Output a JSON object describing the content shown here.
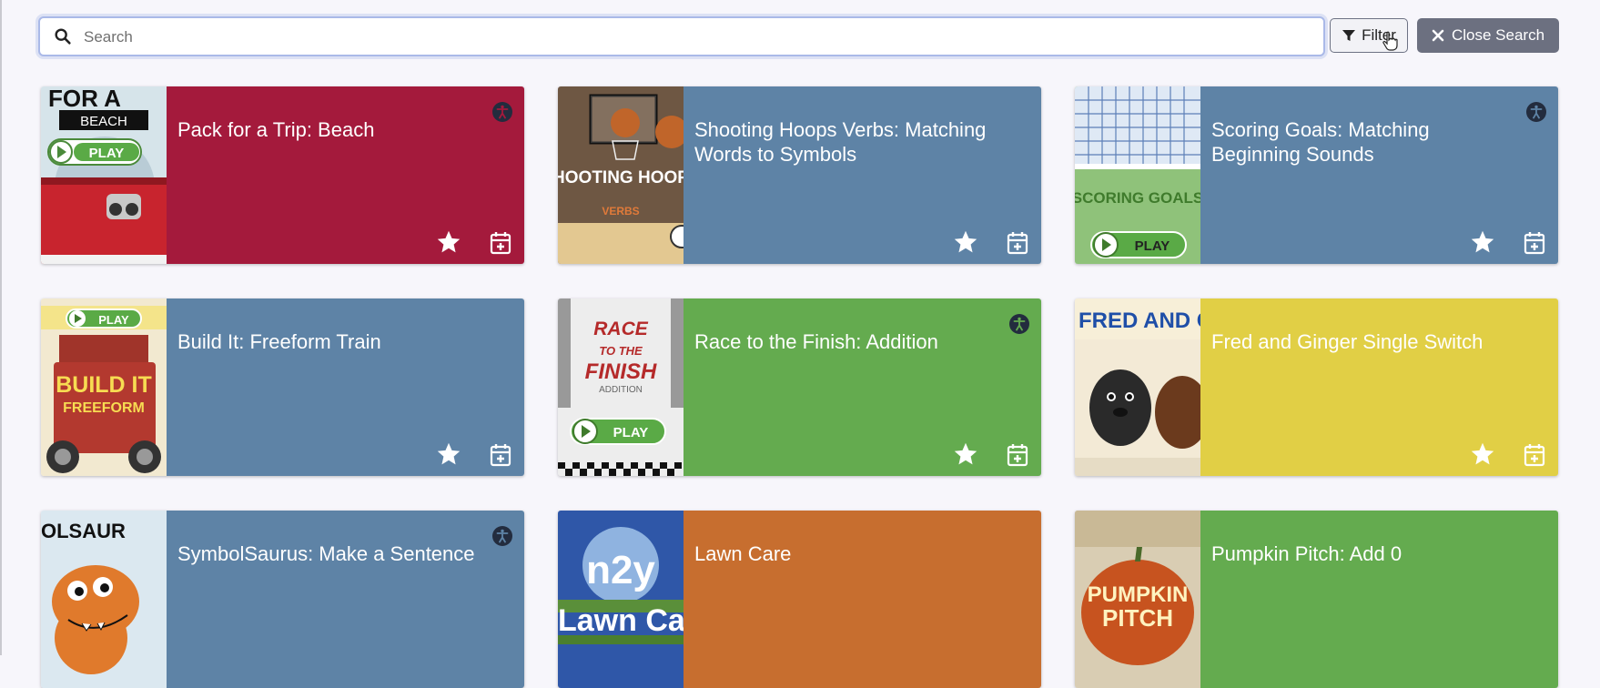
{
  "search": {
    "placeholder": "Search",
    "value": ""
  },
  "toolbar": {
    "filter_label": "Filter",
    "close_label": "Close Search"
  },
  "cards": [
    {
      "title": "Pack for a Trip: Beach",
      "color": "#a41a3c",
      "accessible": true,
      "thumb_caption": "BEACH",
      "thumb_text_2": "PLAY"
    },
    {
      "title": "Shooting Hoops Verbs: Matching Words to Symbols",
      "color": "#5e83a6",
      "accessible": false,
      "thumb_caption": "SHOOTING HOOPS",
      "thumb_text_2": "VERBS"
    },
    {
      "title": "Scoring Goals: Matching Beginning Sounds",
      "color": "#5e83a6",
      "accessible": true,
      "thumb_caption": "SCORING GOALS",
      "thumb_text_2": "PLAY"
    },
    {
      "title": "Build It: Freeform Train",
      "color": "#5e83a6",
      "accessible": false,
      "thumb_caption": "BUILD IT",
      "thumb_text_2": "FREEFORM"
    },
    {
      "title": "Race to the Finish: Addition",
      "color": "#64ab4f",
      "accessible": true,
      "thumb_caption": "RACE TO THE FINISH",
      "thumb_text_2": "PLAY"
    },
    {
      "title": "Fred and Ginger Single Switch",
      "color": "#e1cf45",
      "accessible": false,
      "thumb_caption": "FRED AND G",
      "thumb_text_2": ""
    },
    {
      "title": "SymbolSaurus: Make a Sentence",
      "color": "#5e83a6",
      "accessible": true,
      "thumb_caption": "OLSAUR",
      "thumb_text_2": ""
    },
    {
      "title": "Lawn Care",
      "color": "#c76e2f",
      "accessible": false,
      "thumb_caption": "n2y",
      "thumb_text_2": "Lawn Car"
    },
    {
      "title": "Pumpkin Pitch: Add 0",
      "color": "#64ab4f",
      "accessible": false,
      "thumb_caption": "PUMPKIN",
      "thumb_text_2": "PITCH"
    }
  ]
}
